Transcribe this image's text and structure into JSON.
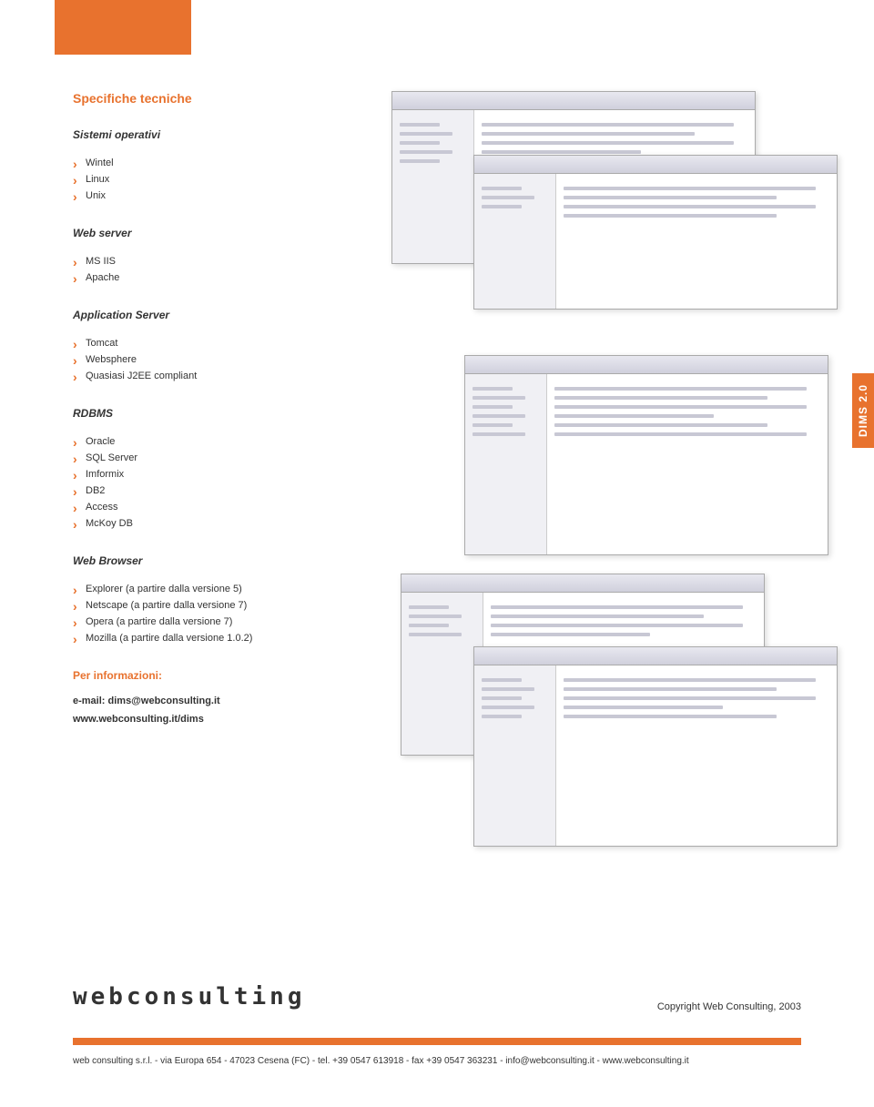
{
  "page_title": "Specifiche tecniche",
  "sections": {
    "os": {
      "heading": "Sistemi operativi",
      "items": [
        "Wintel",
        "Linux",
        "Unix"
      ]
    },
    "webserver": {
      "heading": "Web server",
      "items": [
        "MS IIS",
        "Apache"
      ]
    },
    "appserver": {
      "heading": "Application Server",
      "items": [
        "Tomcat",
        "Websphere",
        "Quasiasi J2EE compliant"
      ]
    },
    "rdbms": {
      "heading": "RDBMS",
      "items": [
        "Oracle",
        "SQL Server",
        "Imformix",
        "DB2",
        "Access",
        "McKoy DB"
      ]
    },
    "browser": {
      "heading": "Web Browser",
      "items": [
        "Explorer (a partire dalla versione 5)",
        "Netscape (a partire dalla versione 7)",
        "Opera (a partire dalla versione 7)",
        "Mozilla (a partire dalla versione 1.0.2)"
      ]
    }
  },
  "info": {
    "heading": "Per informazioni:",
    "email": "e-mail: dims@webconsulting.it",
    "url": "www.webconsulting.it/dims"
  },
  "side_tag": "DIMS 2.0",
  "logo_text": "webconsulting",
  "copyright": "Copyright Web Consulting, 2003",
  "footer": "web consulting s.r.l. - via Europa 654 - 47023 Cesena (FC) - tel. +39 0547 613918 - fax +39 0547 363231 - info@webconsulting.it - www.webconsulting.it"
}
